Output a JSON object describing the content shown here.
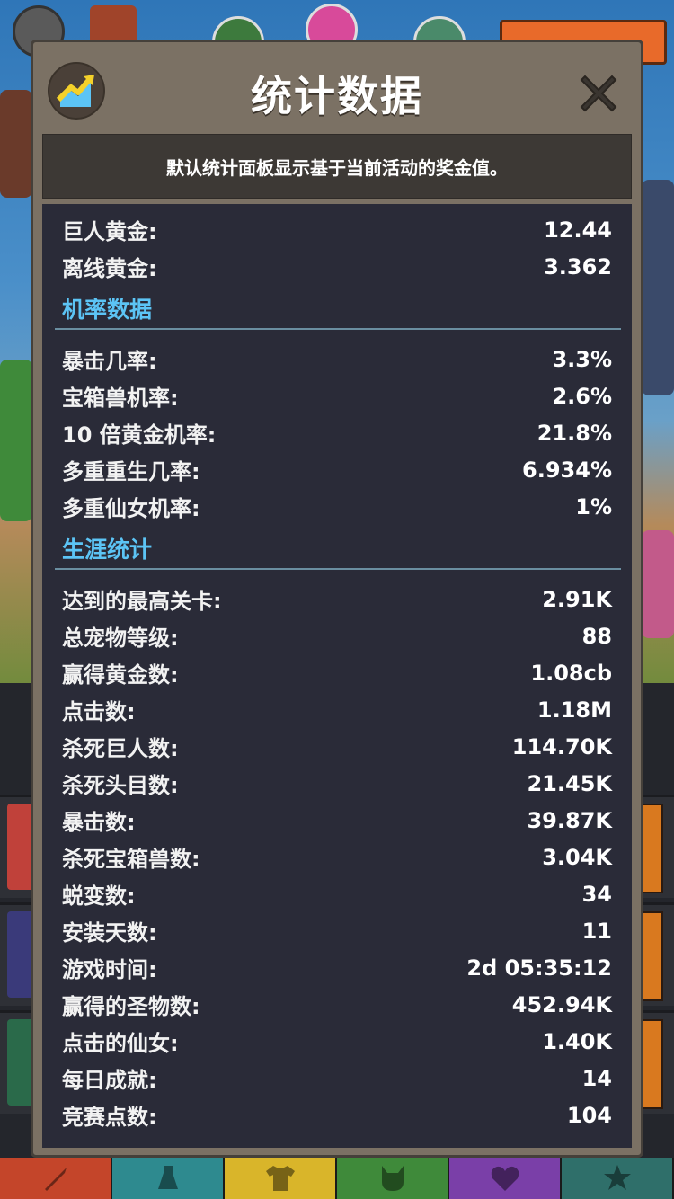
{
  "dialog": {
    "title": "统计数据",
    "description": "默认统计面板显示基于当前活动的奖金值。",
    "icon": "rising-chart-icon",
    "close_icon": "close-icon"
  },
  "top_stats": [
    {
      "label": "巨人黄金:",
      "value": "12.44"
    },
    {
      "label": "离线黄金:",
      "value": "3.362"
    }
  ],
  "sections": [
    {
      "title": "机率数据",
      "rows": [
        {
          "label": "暴击几率:",
          "value": "3.3%"
        },
        {
          "label": "宝箱兽机率:",
          "value": "2.6%"
        },
        {
          "label": "10 倍黄金机率:",
          "value": "21.8%"
        },
        {
          "label": "多重重生几率:",
          "value": "6.934%"
        },
        {
          "label": "多重仙女机率:",
          "value": "1%"
        }
      ]
    },
    {
      "title": "生涯统计",
      "rows": [
        {
          "label": "达到的最高关卡:",
          "value": "2.91K"
        },
        {
          "label": "总宠物等级:",
          "value": "88"
        },
        {
          "label": "赢得黄金数:",
          "value": "1.08cb"
        },
        {
          "label": "点击数:",
          "value": "1.18M"
        },
        {
          "label": "杀死巨人数:",
          "value": "114.70K"
        },
        {
          "label": "杀死头目数:",
          "value": "21.45K"
        },
        {
          "label": "暴击数:",
          "value": "39.87K"
        },
        {
          "label": "杀死宝箱兽数:",
          "value": "3.04K"
        },
        {
          "label": "蜕变数:",
          "value": "34"
        },
        {
          "label": "安装天数:",
          "value": "11"
        },
        {
          "label": "游戏时间:",
          "value": "2d 05:35:12"
        },
        {
          "label": "赢得的圣物数:",
          "value": "452.94K"
        },
        {
          "label": "点击的仙女:",
          "value": "1.40K"
        },
        {
          "label": "每日成就:",
          "value": "14"
        },
        {
          "label": "竞赛点数:",
          "value": "104"
        }
      ]
    }
  ],
  "bottom_tabs": [
    {
      "icon": "sword-icon",
      "color": "#c4452a"
    },
    {
      "icon": "flask-icon",
      "color": "#2e8a8f"
    },
    {
      "icon": "shirt-icon",
      "color": "#d9b52a"
    },
    {
      "icon": "pet-icon",
      "color": "#3f8a3a"
    },
    {
      "icon": "heart-icon",
      "color": "#7a3fa8"
    },
    {
      "icon": "star-icon",
      "color": "#2f6f6a"
    }
  ],
  "colors": {
    "dialog_frame": "#7b7164",
    "panel_bg": "#2a2b38",
    "section_title": "#5cc4f5"
  }
}
